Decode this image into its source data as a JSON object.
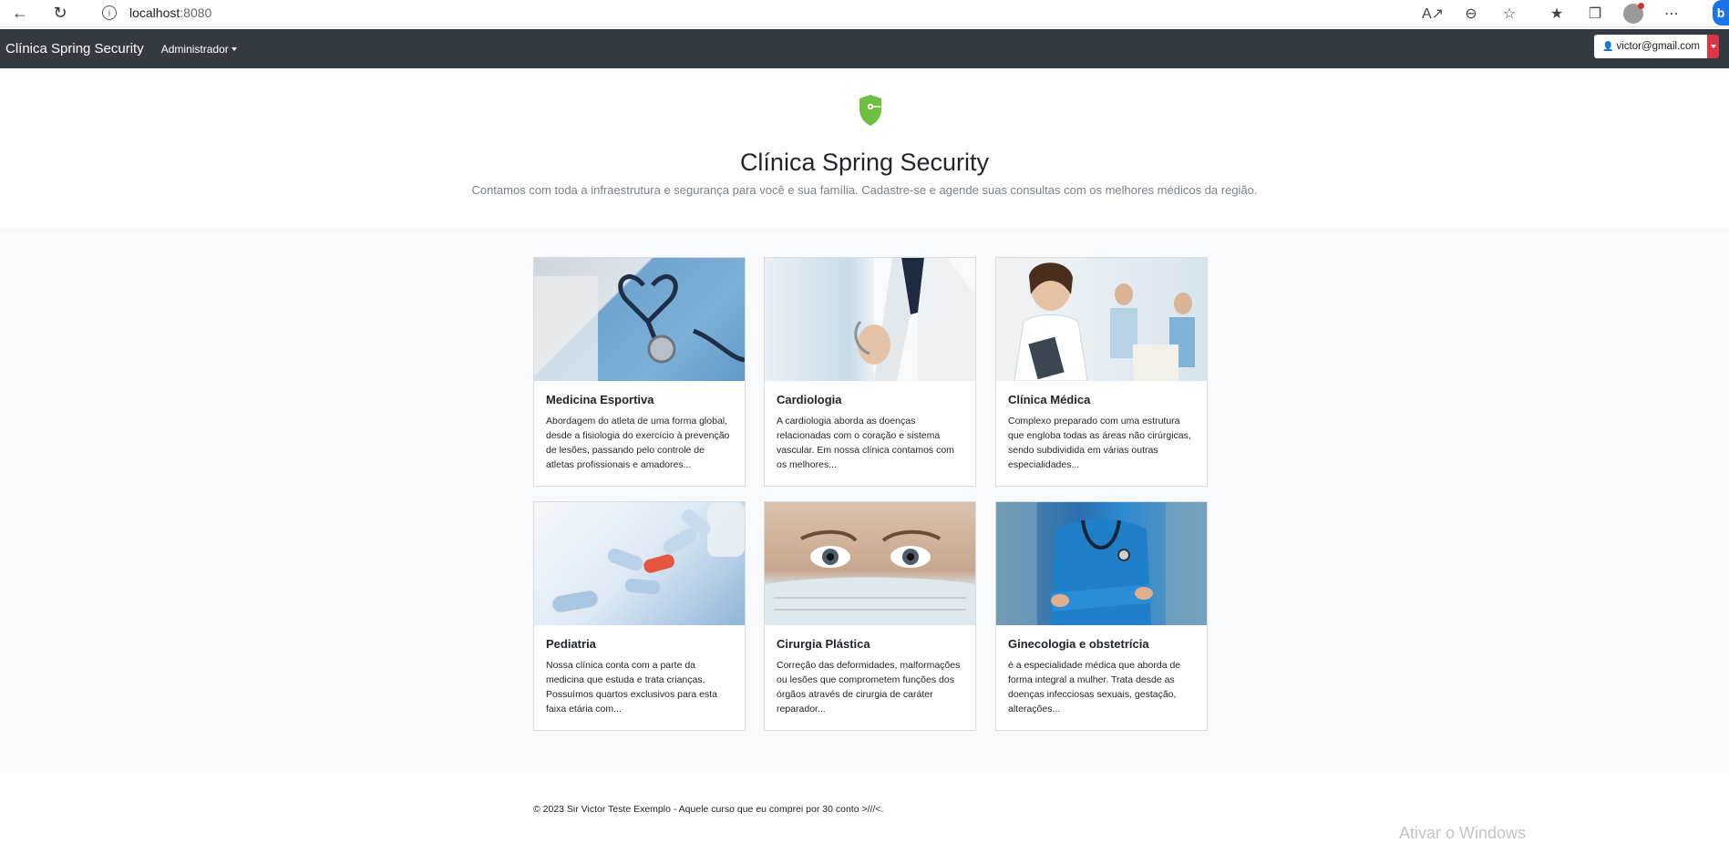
{
  "browser": {
    "url_host": "localhost",
    "url_port": ":8080"
  },
  "navbar": {
    "brand": "Clínica Spring Security",
    "menu_admin": "Administrador",
    "user_email": "victor@gmail.com"
  },
  "hero": {
    "title": "Clínica Spring Security",
    "subtitle": "Contamos com toda a infraestrutura e segurança para você e sua família. Cadastre-se e agende suas consultas com os melhores médicos da região."
  },
  "cards": [
    {
      "title": "Medicina Esportiva",
      "text": "Abordagem do atleta de uma forma global, desde a fisiologia do exercício à prevenção de lesões, passando pelo controle de atletas profissionais e amadores..."
    },
    {
      "title": "Cardiologia",
      "text": "A cardiologia aborda as doenças relacionadas com o coração e sistema vascular. Em nossa clínica contamos com os melhores..."
    },
    {
      "title": "Clínica Médica",
      "text": "Complexo preparado com uma estrutura que engloba todas as áreas não cirúrgicas, sendo subdividida em várias outras especialidades..."
    },
    {
      "title": "Pediatria",
      "text": "Nossa clínica conta com a parte da medicina que estuda e trata crianças. Possuímos quartos exclusivos para esta faixa etária com..."
    },
    {
      "title": "Cirurgia Plástica",
      "text": "Correção das deformidades, malformações ou lesões que comprometem funções dos órgãos através de cirurgia de caráter reparador..."
    },
    {
      "title": "Ginecologia e obstetrícia",
      "text": "é a especialidade médica que aborda de forma integral a mulher. Trata desde as doenças infecciosas sexuais, gestação, alterações..."
    }
  ],
  "footer": {
    "text": "© 2023 Sir Victor Teste Exemplo - Aquele curso que eu comprei por 30 conto >///<.",
    "watermark": "Ativar o Windows"
  },
  "colors": {
    "navbar_bg": "#343a40",
    "user_split": "#dc3545",
    "shield": "#6cbf3f"
  }
}
